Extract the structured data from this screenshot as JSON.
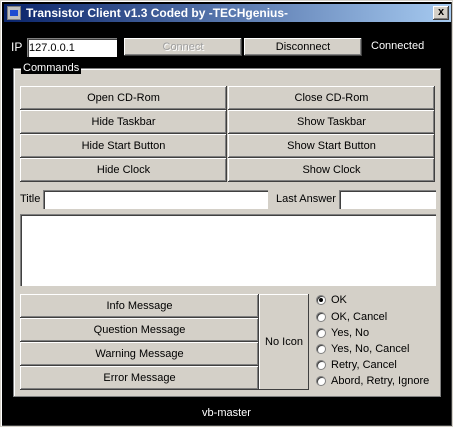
{
  "window": {
    "title": "Transistor Client v1.3 Coded by -TECHgenius-",
    "close_label": "x"
  },
  "connection": {
    "ip_label": "IP",
    "ip_value": "127.0.0.1",
    "connect_label": "Connect",
    "disconnect_label": "Disconnect",
    "status": "Connected"
  },
  "commands": {
    "legend": "Commands",
    "buttons": [
      "Open CD-Rom",
      "Close CD-Rom",
      "Hide Taskbar",
      "Show Taskbar",
      "Hide Start Button",
      "Show Start Button",
      "Hide Clock",
      "Show Clock"
    ],
    "title_label": "Title",
    "title_value": "",
    "last_answer_label": "Last Answer",
    "last_answer_value": "",
    "message_text": ""
  },
  "messages": {
    "buttons": [
      "Info Message",
      "Question Message",
      "Warning Message",
      "Error Message"
    ],
    "icon_label": "No Icon"
  },
  "button_types": {
    "options": [
      "OK",
      "OK, Cancel",
      "Yes, No",
      "Yes, No, Cancel",
      "Retry, Cancel",
      "Abord, Retry, Ignore"
    ],
    "selected": "OK"
  },
  "footer": {
    "text": "vb-master"
  }
}
